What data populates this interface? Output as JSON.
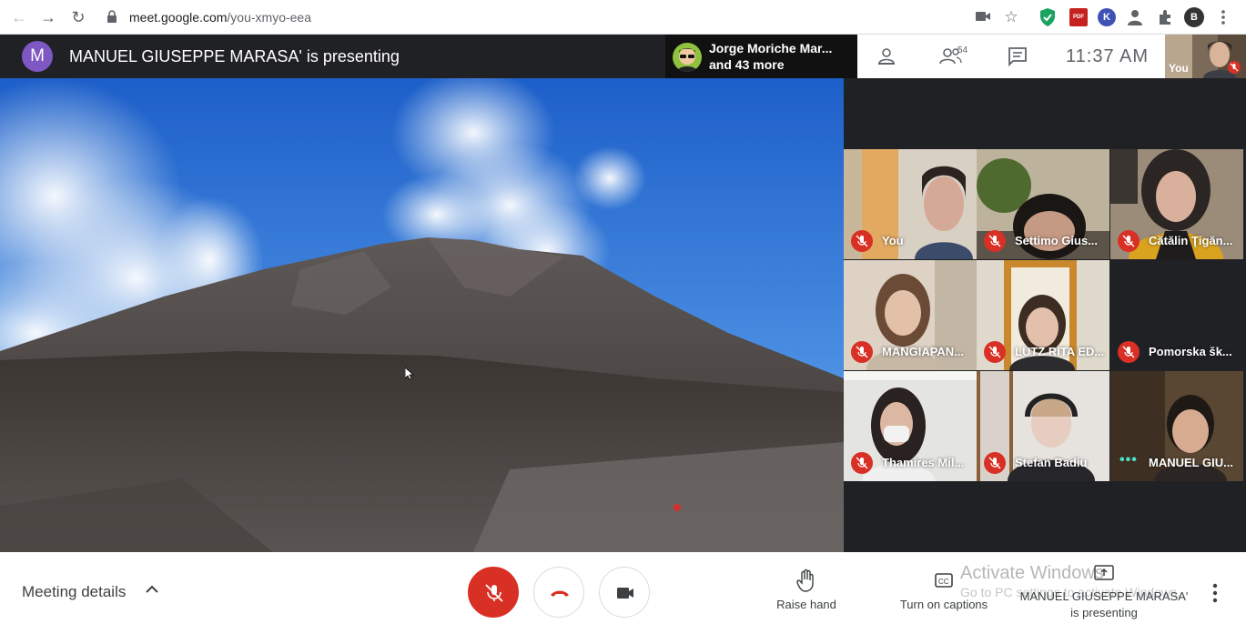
{
  "browser": {
    "url_host": "meet.google.com",
    "url_path": "/you-xmyo-eea",
    "profile_initial": "B",
    "ext_k": "K",
    "ext_pdf": "PDF"
  },
  "topbar": {
    "presenter_initial": "M",
    "presenting_title": "MANUEL GIUSEPPE MARASA' is presenting",
    "speaker_name": "Jorge Moriche Mar...",
    "speaker_more": "and 43 more",
    "participant_count": "54",
    "clock": "11:37  AM",
    "self_label": "You"
  },
  "tiles": [
    {
      "name": "You"
    },
    {
      "name": "Settimo Gius..."
    },
    {
      "name": "Cătălin Ţigăn..."
    },
    {
      "name": "MANGIAPAN..."
    },
    {
      "name": "LUTZ RITA ED..."
    },
    {
      "name": "Pomorska šk..."
    },
    {
      "name": "Thamires Mil..."
    },
    {
      "name": "Stefan Badiu"
    },
    {
      "name": "MANUEL GIU..."
    }
  ],
  "bottombar": {
    "meeting_details": "Meeting details",
    "raise_hand": "Raise hand",
    "captions": "Turn on captions",
    "watermark_title": "Activate Windows",
    "watermark_sub": "Go to PC settings to activate Windows.",
    "present_line1": "MANUEL GIUSEPPE MARASA'",
    "present_line2": "is presenting"
  },
  "colors": {
    "end_call_red": "#d93025",
    "mic_muted_red": "#d93025",
    "dark_bg": "#202124",
    "presenter_avatar": "#7e57c2"
  }
}
